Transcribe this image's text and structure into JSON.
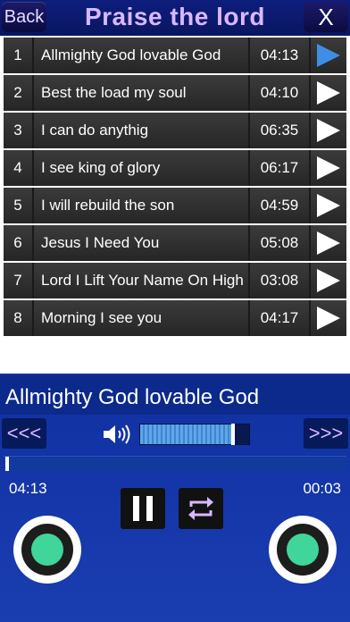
{
  "header": {
    "back_label": "Back",
    "title": "Praise the lord",
    "close_label": "X"
  },
  "songs": [
    {
      "num": "1",
      "name": "Allmighty God lovable God",
      "time": "04:13"
    },
    {
      "num": "2",
      "name": "Best the load my soul",
      "time": "04:10"
    },
    {
      "num": "3",
      "name": "I can do anythig",
      "time": "06:35"
    },
    {
      "num": "4",
      "name": "I see king of glory",
      "time": "06:17"
    },
    {
      "num": "5",
      "name": "I will rebuild the son",
      "time": "04:59"
    },
    {
      "num": "6",
      "name": "Jesus I Need You",
      "time": "05:08"
    },
    {
      "num": "7",
      "name": "Lord I Lift Your Name On High",
      "time": "03:08"
    },
    {
      "num": "8",
      "name": "Morning I see you",
      "time": "04:17"
    }
  ],
  "now_playing": "Allmighty God lovable God",
  "controls": {
    "prev_label": "<<<",
    "next_label": ">>>",
    "volume_level": 0.85
  },
  "progress": {
    "elapsed_left": "04:13",
    "elapsed_right": "00:03"
  },
  "colors": {
    "accent": "#d9b8ff",
    "active_play": "#3f8ee6",
    "knob_dot": "#3fd59b"
  }
}
